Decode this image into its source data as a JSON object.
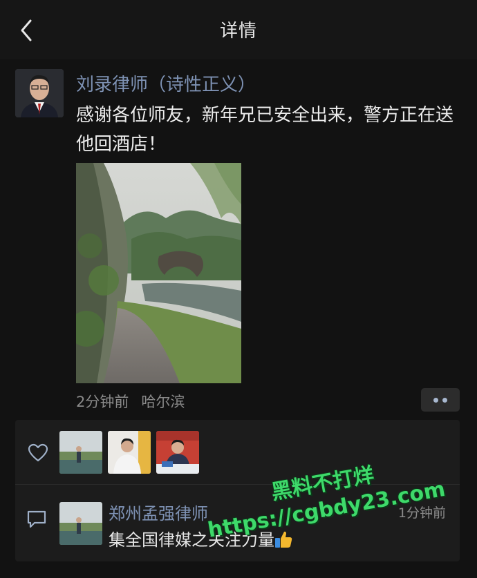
{
  "header": {
    "title": "详情",
    "back_icon": "chevron-left-icon"
  },
  "post": {
    "author": "刘录律师（诗性正义）",
    "text": "感谢各位师友，新年兄已安全出来，警方正在送他回酒店！",
    "time": "2分钟前",
    "location": "哈尔滨",
    "more_icon": "more-dots-icon"
  },
  "likes": {
    "icon": "heart-outline-icon",
    "avatars": [
      "liker-1",
      "liker-2",
      "liker-3"
    ]
  },
  "comment": {
    "icon": "comment-icon",
    "name": "郑州孟强律师",
    "time": "1分钟前",
    "text": "集全国律媒之关注力量",
    "emoji": "thumbs-up-icon"
  },
  "watermark": {
    "line1": "黑料不打烊",
    "line2": "https://cgbdy23.com"
  },
  "colors": {
    "background": "#121212",
    "link_name": "#7e92b4",
    "watermark": "#3ed96a"
  }
}
